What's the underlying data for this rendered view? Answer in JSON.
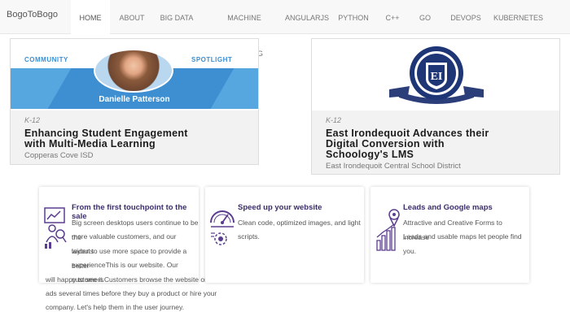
{
  "navbar": {
    "brand": "BogoToBogo",
    "items": [
      "HOME",
      "ABOUT",
      "BIG DATA",
      "MACHINE LEARNING",
      "ANGULARJS",
      "PYTHON",
      "C++",
      "GO",
      "DEVOPS",
      "KUBERNETES"
    ],
    "active_index": 0
  },
  "cards": [
    {
      "banner_left": "COMMUNITY",
      "banner_right": "SPOTLIGHT",
      "banner_name": "Danielle Patterson",
      "tag": "K-12",
      "title_line1": "Enhancing Student Engagement",
      "title_line2": "with Multi-Media Learning",
      "subtitle": "Copperas Cove ISD"
    },
    {
      "seal_initials": "EI",
      "tag": "K-12",
      "title_line1": "East Irondequoit Advances their",
      "title_line2": "Digital Conversion with",
      "title_line3": "Schoology's LMS",
      "subtitle": "East Irondequoit Central School District"
    }
  ],
  "features": [
    {
      "icon": "analytics-person-icon",
      "title": "From the first touchpoint to the sale",
      "lines": [
        "Big screen desktops users continue to be the",
        "more valuable customers, and our layouts",
        "widen to use more space to provide a better",
        "experienceThis is our website. Our customers",
        "will happy to see it.Customers browse the website or see",
        "ads several times before they buy a product or hire your",
        "company. Let's help them in the user journey."
      ]
    },
    {
      "icon": "speedometer-icon",
      "title": "Speed up your website",
      "lines": [
        "Clean code, optimized images, and light",
        "scripts."
      ]
    },
    {
      "icon": "growth-chart-icon",
      "title": "Leads and Google maps",
      "lines": [
        "Attractive and Creative Forms to increase",
        "Leads and usable maps let people find you."
      ]
    }
  ],
  "colors": {
    "accent_purple": "#5a3d8f",
    "banner_blue": "#56a6e0",
    "navbar_bg": "#f8f8f8"
  }
}
